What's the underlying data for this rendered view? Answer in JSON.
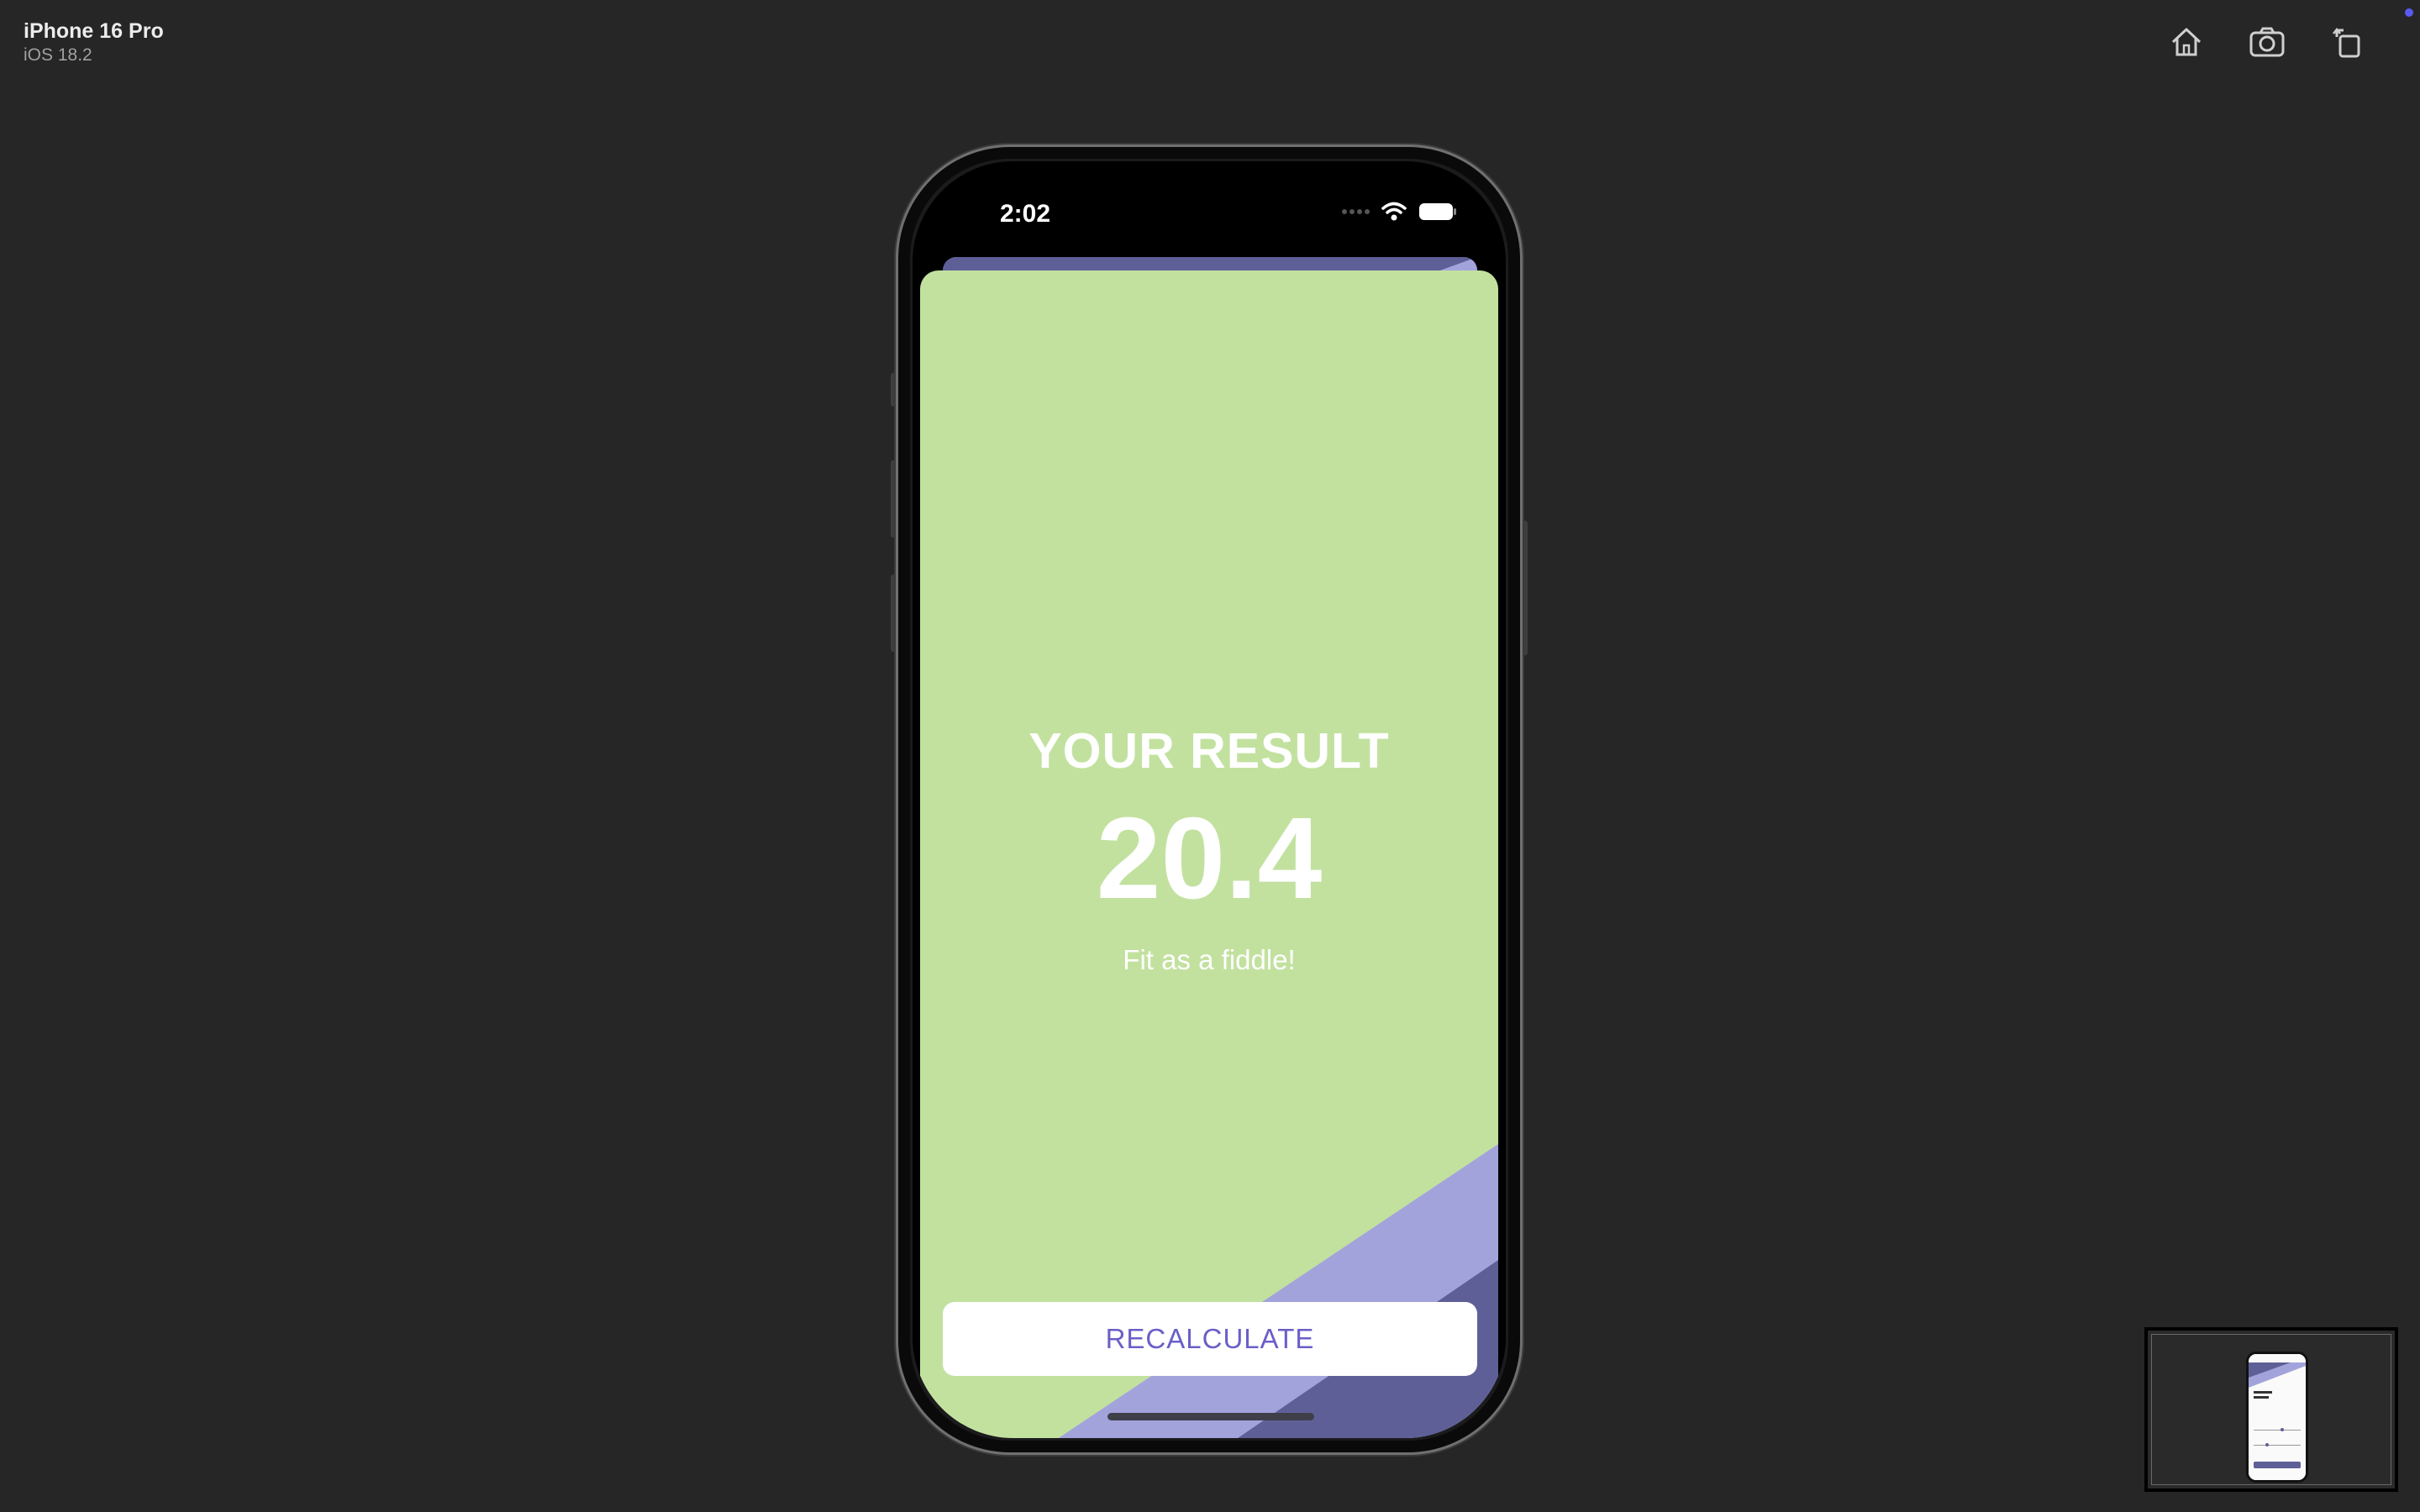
{
  "simulator": {
    "device_name": "iPhone 16 Pro",
    "os_version": "iOS 18.2"
  },
  "toolbar": {
    "home_icon": "home-icon",
    "screenshot_icon": "camera-icon",
    "rotate_icon": "rotate-icon"
  },
  "status_bar": {
    "time": "2:02"
  },
  "result": {
    "title": "YOUR RESULT",
    "value": "20.4",
    "advice": "Fit as a fiddle!",
    "recalculate_label": "RECALCULATE"
  },
  "colors": {
    "background": "#262626",
    "sheet_green": "#c2e19f",
    "light_purple": "#a3a3dc",
    "dark_purple": "#5f5f98",
    "button_text": "#6a5fc8"
  }
}
